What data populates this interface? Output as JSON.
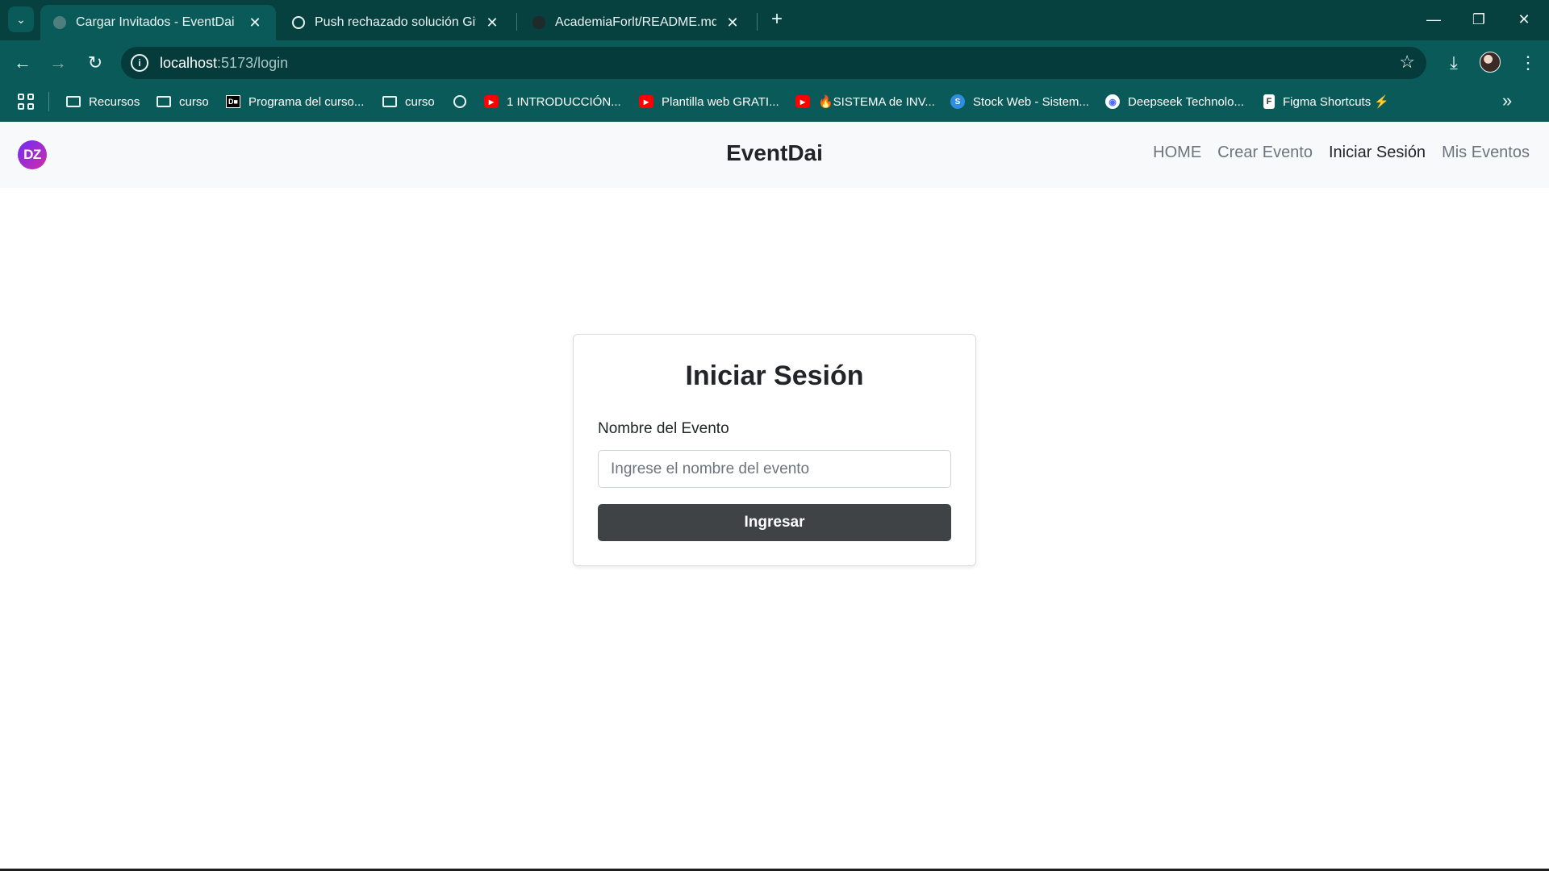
{
  "browser": {
    "tabs": [
      {
        "title": "Cargar Invitados - EventDai",
        "active": true,
        "icon": "globe-icon"
      },
      {
        "title": "Push rechazado solución Git",
        "active": false,
        "icon": "chatgpt-icon"
      },
      {
        "title": "AcademiaForlt/README.md at r",
        "active": false,
        "icon": "github-icon"
      }
    ],
    "url_host": "localhost",
    "url_path": ":5173/login",
    "bookmarks": [
      {
        "label": "Recursos",
        "icon": "folder-icon"
      },
      {
        "label": "curso",
        "icon": "folder-icon"
      },
      {
        "label": "Programa del curso...",
        "icon": "dark-icon"
      },
      {
        "label": "curso",
        "icon": "folder-icon"
      },
      {
        "label": "",
        "icon": "globe-icon"
      },
      {
        "label": "1 INTRODUCCIÓN...",
        "icon": "youtube-icon"
      },
      {
        "label": "Plantilla web GRATI...",
        "icon": "youtube-icon"
      },
      {
        "label": "🔥SISTEMA de INV...",
        "icon": "youtube-icon"
      },
      {
        "label": "Stock Web - Sistem...",
        "icon": "blue-icon"
      },
      {
        "label": "Deepseek Technolo...",
        "icon": "deepseek-icon"
      },
      {
        "label": "Figma Shortcuts ⚡",
        "icon": "figma-icon"
      }
    ]
  },
  "app": {
    "logo_text": "DZ",
    "brand": "EventDai",
    "nav": [
      {
        "label": "HOME",
        "active": false
      },
      {
        "label": "Crear Evento",
        "active": false
      },
      {
        "label": "Iniciar Sesión",
        "active": true
      },
      {
        "label": "Mis Eventos",
        "active": false
      }
    ],
    "login": {
      "title": "Iniciar Sesión",
      "field_label": "Nombre del Evento",
      "field_placeholder": "Ingrese el nombre del evento",
      "field_value": "",
      "submit_label": "Ingresar"
    }
  },
  "colors": {
    "chrome_bg": "#0b5a5a",
    "tabstrip_bg": "#06403f",
    "button_dark": "#3f4346",
    "nav_bg": "#f8f9fa"
  }
}
